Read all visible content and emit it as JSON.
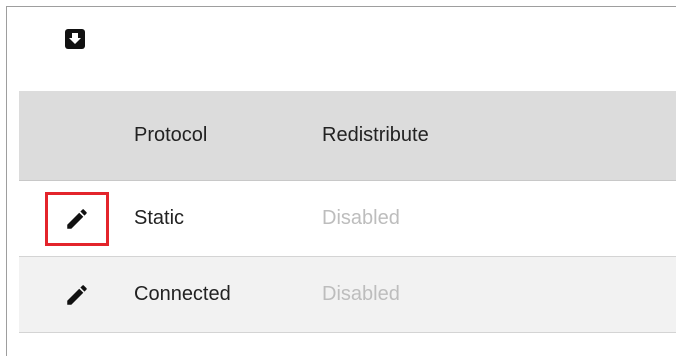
{
  "toolbar": {
    "export_icon": "export-download-icon"
  },
  "table": {
    "columns": [
      "",
      "Protocol",
      "Redistribute"
    ],
    "rows": [
      {
        "protocol": "Static",
        "redistribute": "Disabled",
        "highlighted": true
      },
      {
        "protocol": "Connected",
        "redistribute": "Disabled",
        "highlighted": false
      }
    ]
  },
  "colors": {
    "header_bg": "#dcdcdc",
    "alt_row_bg": "#f2f2f2",
    "highlight": "#e3242b",
    "disabled_text": "#bdbdbd"
  }
}
